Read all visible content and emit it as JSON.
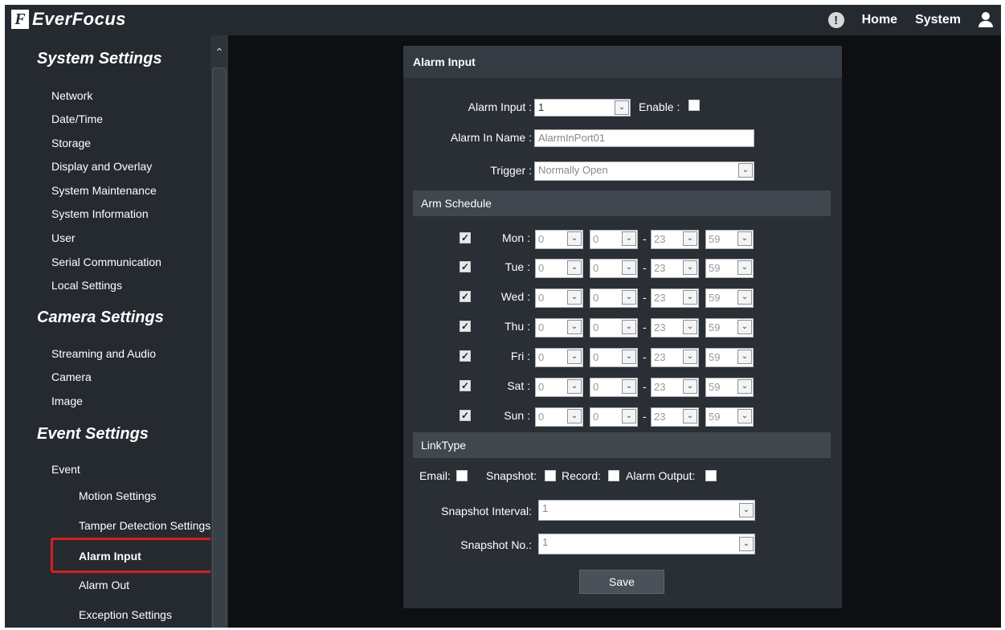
{
  "app": {
    "brand_mark": "F",
    "brand_text": "EverFocus"
  },
  "topbar": {
    "alert_glyph": "!",
    "home_label": "Home",
    "system_label": "System"
  },
  "sidebar": {
    "scroll_up_glyph": "⌃",
    "sections": [
      {
        "title": "System Settings",
        "items": [
          "Network",
          "Date/Time",
          "Storage",
          "Display and Overlay",
          "System Maintenance",
          "System Information",
          "User",
          "Serial Communication",
          "Local Settings"
        ]
      },
      {
        "title": "Camera Settings",
        "items": [
          "Streaming and Audio",
          "Camera",
          "Image"
        ]
      },
      {
        "title": "Event Settings",
        "items": [
          "Event"
        ],
        "subitems": [
          "Motion Settings",
          "Tamper Detection Settings",
          "Alarm Input",
          "Alarm Out",
          "Exception Settings"
        ],
        "active_subitem": "Alarm Input"
      }
    ]
  },
  "panel": {
    "title": "Alarm Input",
    "alarm_input": {
      "label": "Alarm Input :",
      "value": "1",
      "enable_label": "Enable :",
      "enabled": false
    },
    "alarm_name": {
      "label": "Alarm In Name :",
      "value": "AlarmInPort01"
    },
    "trigger": {
      "label": "Trigger :",
      "value": "Normally Open"
    },
    "arm_schedule": {
      "title": "Arm Schedule",
      "check_glyph": "✓",
      "dropdown_glyph": "⌄",
      "separator": "-",
      "days": [
        {
          "day": "Mon :",
          "checked": true,
          "start_h": "0",
          "start_m": "0",
          "end_h": "23",
          "end_m": "59"
        },
        {
          "day": "Tue :",
          "checked": true,
          "start_h": "0",
          "start_m": "0",
          "end_h": "23",
          "end_m": "59"
        },
        {
          "day": "Wed :",
          "checked": true,
          "start_h": "0",
          "start_m": "0",
          "end_h": "23",
          "end_m": "59"
        },
        {
          "day": "Thu :",
          "checked": true,
          "start_h": "0",
          "start_m": "0",
          "end_h": "23",
          "end_m": "59"
        },
        {
          "day": "Fri :",
          "checked": true,
          "start_h": "0",
          "start_m": "0",
          "end_h": "23",
          "end_m": "59"
        },
        {
          "day": "Sat :",
          "checked": true,
          "start_h": "0",
          "start_m": "0",
          "end_h": "23",
          "end_m": "59"
        },
        {
          "day": "Sun :",
          "checked": true,
          "start_h": "0",
          "start_m": "0",
          "end_h": "23",
          "end_m": "59"
        }
      ]
    },
    "link_type": {
      "title": "LinkType",
      "email_label": "Email:",
      "snapshot_label": "Snapshot:",
      "record_label": "Record:",
      "alarm_output_label": "Alarm Output:",
      "snapshot_interval": {
        "label": "Snapshot Interval:",
        "value": "1"
      },
      "snapshot_no": {
        "label": "Snapshot No.:",
        "value": "1"
      }
    },
    "save_label": "Save"
  }
}
